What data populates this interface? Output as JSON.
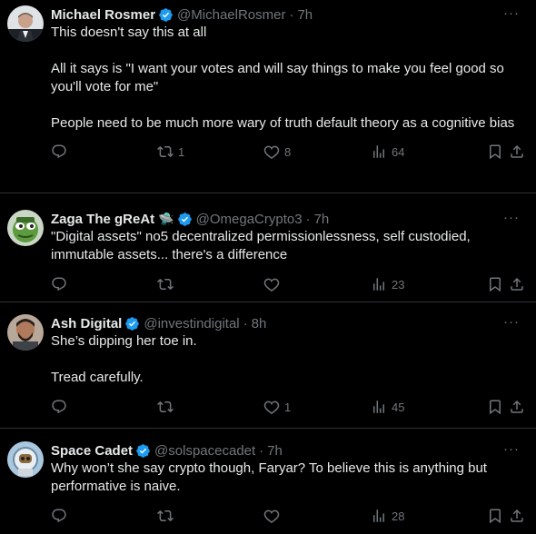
{
  "tweets": [
    {
      "name": "Michael Rosmer",
      "name_emoji": "",
      "handle": "@MichaelRosmer",
      "separator": "·",
      "time": "7h",
      "more": "···",
      "paragraphs": [
        "This doesn't say this at all",
        "",
        "All it says is \"I want your votes and will say things to make you feel good so you'll vote for me\"",
        "",
        "People need to be much more wary of truth default theory as a cognitive bias"
      ],
      "reposts": "1",
      "likes": "8",
      "views": "64",
      "avatar": "avatar-person-suit"
    },
    {
      "name": "Zaga The gReAt",
      "name_emoji": "🛸",
      "handle": "@OmegaCrypto3",
      "separator": "·",
      "time": "7h",
      "more": "···",
      "paragraphs": [
        "\"Digital assets\" no5 decentralized permissionlessness, self custodied, immutable assets... there's a difference"
      ],
      "reposts": "",
      "likes": "",
      "views": "23",
      "avatar": "avatar-green-pepe"
    },
    {
      "name": "Ash Digital",
      "name_emoji": "",
      "handle": "@investindigital",
      "separator": "·",
      "time": "8h",
      "more": "···",
      "paragraphs": [
        "She’s dipping her toe in.",
        "",
        "Tread carefully."
      ],
      "reposts": "",
      "likes": "1",
      "views": "45",
      "avatar": "avatar-bearded-man"
    },
    {
      "name": "Space Cadet",
      "name_emoji": "",
      "handle": "@solspacecadet",
      "separator": "·",
      "time": "7h",
      "more": "···",
      "paragraphs": [
        "Why won’t she say crypto though, Faryar? To believe this is anything but performative is naive."
      ],
      "reposts": "",
      "likes": "",
      "views": "28",
      "avatar": "avatar-astronaut-cartoon"
    }
  ],
  "colors": {
    "background": "#000000",
    "text": "#e7e9ea",
    "muted": "#71767b",
    "divider": "#2f3336",
    "verified": "#1d9bf0"
  },
  "icons": [
    "reply-icon",
    "repost-icon",
    "like-icon",
    "views-icon",
    "bookmark-icon",
    "share-icon",
    "verified-badge-icon",
    "more-icon"
  ]
}
